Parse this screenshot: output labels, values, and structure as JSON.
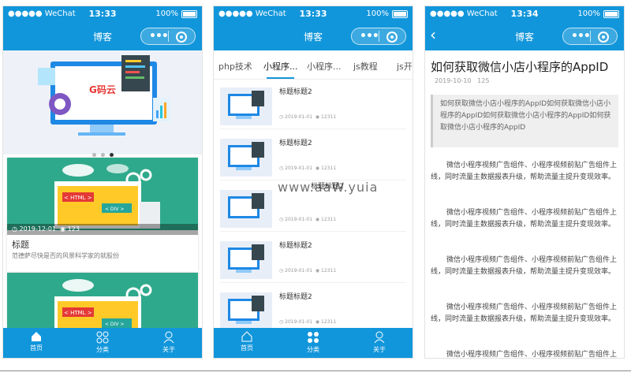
{
  "status": {
    "carrier": "●●●●● WeChat",
    "battery": "100%"
  },
  "phones": [
    {
      "time": "13:33",
      "nav_title": "博客",
      "cards": [
        {
          "date": "2019-12-01",
          "views": "123",
          "title": "标题",
          "desc": "范德萨尽快是否的风景科学家的就股份"
        }
      ]
    },
    {
      "time": "13:33",
      "nav_title": "博客",
      "categories": [
        "php技术",
        "小程序...",
        "小程序...",
        "js教程",
        "js开"
      ],
      "articles": [
        {
          "title": "标题标题2",
          "date": "2019-01-01",
          "views": "12311"
        },
        {
          "title": "标题标题2",
          "date": "2019-01-01",
          "views": "12311"
        },
        {
          "title": "标题标题2",
          "date": "2019-01-01",
          "views": "12311"
        },
        {
          "title": "标题标题2",
          "date": "2019-01-01",
          "views": "12311"
        },
        {
          "title": "标题标题2",
          "date": "2019-01-01",
          "views": "12311"
        }
      ]
    },
    {
      "time": "13:34",
      "nav_title": "博客",
      "post_title": "如何获取微信小店小程序的AppID",
      "post_date": "2019-10-10",
      "post_views": "125",
      "quote": "如何获取微信小店小程序的AppID如何获取微信小店小程序的AppID如何获取微信小店小程序的AppID如何获取微信小店小程序的AppID",
      "paragraph": "微信小程序视频广告组件、小程序视频前贴广告组件上线，同时流量主数据报表升级，帮助流量主提升变现效率。"
    }
  ],
  "tabbar": {
    "home": "首页",
    "category": "分类",
    "about": "关于"
  },
  "banner_logo": "G码云",
  "card_html": "< HTML >",
  "card_div": "< DIV >",
  "watermark": "www.aaW.yuia",
  "icons": {
    "clock": "clock-icon",
    "eye": "eye-icon",
    "home": "home-icon",
    "grid": "grid-icon",
    "user": "user-icon",
    "back": "back-icon"
  },
  "colors": {
    "primary": "#1296db",
    "card_bg": "#2fa98b"
  }
}
